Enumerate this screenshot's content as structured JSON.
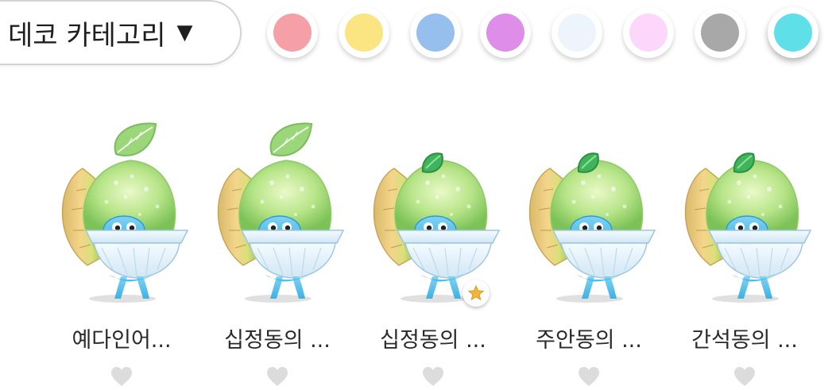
{
  "category": {
    "label": "데코 카테고리",
    "caret": "▼"
  },
  "swatches": [
    {
      "name": "pink-swatch",
      "color": "#f5a0a6"
    },
    {
      "name": "yellow-swatch",
      "color": "#fbe582"
    },
    {
      "name": "blue-swatch",
      "color": "#97bfee"
    },
    {
      "name": "purple-swatch",
      "color": "#de8ee8"
    },
    {
      "name": "white-swatch",
      "color": "#eef4fb"
    },
    {
      "name": "light-pink-swatch",
      "color": "#fcd6fb"
    },
    {
      "name": "gray-swatch",
      "color": "#a8a8a8"
    },
    {
      "name": "cyan-swatch",
      "color": "#5fe0e8",
      "selected": true
    }
  ],
  "items": [
    {
      "name": "예다인어...",
      "leaf": "large",
      "liked": false,
      "favorite": false
    },
    {
      "name": "십정동의 ...",
      "leaf": "large",
      "liked": false,
      "favorite": false
    },
    {
      "name": "십정동의 ...",
      "leaf": "small",
      "liked": false,
      "favorite": true
    },
    {
      "name": "주안동의 ...",
      "leaf": "small",
      "liked": false,
      "favorite": false
    },
    {
      "name": "간석동의 ...",
      "leaf": "small",
      "liked": false,
      "favorite": false
    }
  ],
  "icons": {
    "heart": "heart-icon",
    "star": "star-icon",
    "caret": "caret-down-icon"
  }
}
